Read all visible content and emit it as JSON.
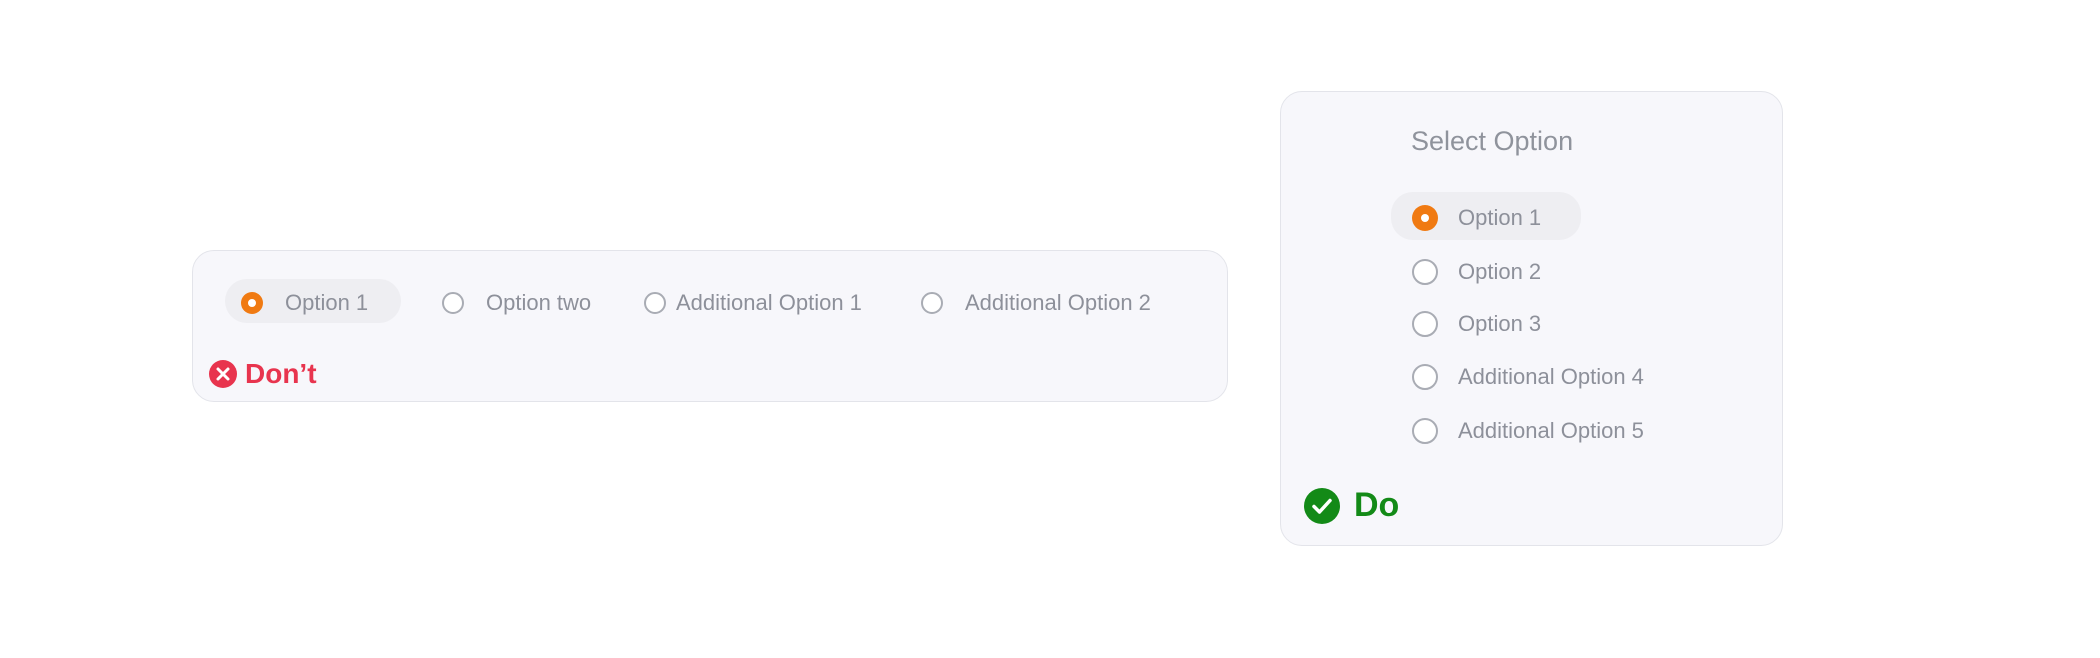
{
  "dont_example": {
    "options": [
      {
        "label": "Option 1",
        "selected": true
      },
      {
        "label": "Option two",
        "selected": false
      },
      {
        "label": "Additional Option 1",
        "selected": false
      },
      {
        "label": "Additional Option 2",
        "selected": false
      }
    ],
    "verdict_label": "Don’t",
    "verdict_icon": "x-circle-icon",
    "verdict_color": "#e8344e"
  },
  "do_example": {
    "title": "Select Option",
    "options": [
      {
        "label": "Option 1",
        "selected": true
      },
      {
        "label": "Option 2",
        "selected": false
      },
      {
        "label": "Option 3",
        "selected": false
      },
      {
        "label": "Additional Option 4",
        "selected": false
      },
      {
        "label": "Additional Option 5",
        "selected": false
      }
    ],
    "verdict_label": "Do",
    "verdict_icon": "check-circle-icon",
    "verdict_color": "#138a17"
  },
  "colors": {
    "selected_radio": "#f07a12",
    "card_background": "#f7f7fb",
    "label_text": "#8d909a"
  }
}
